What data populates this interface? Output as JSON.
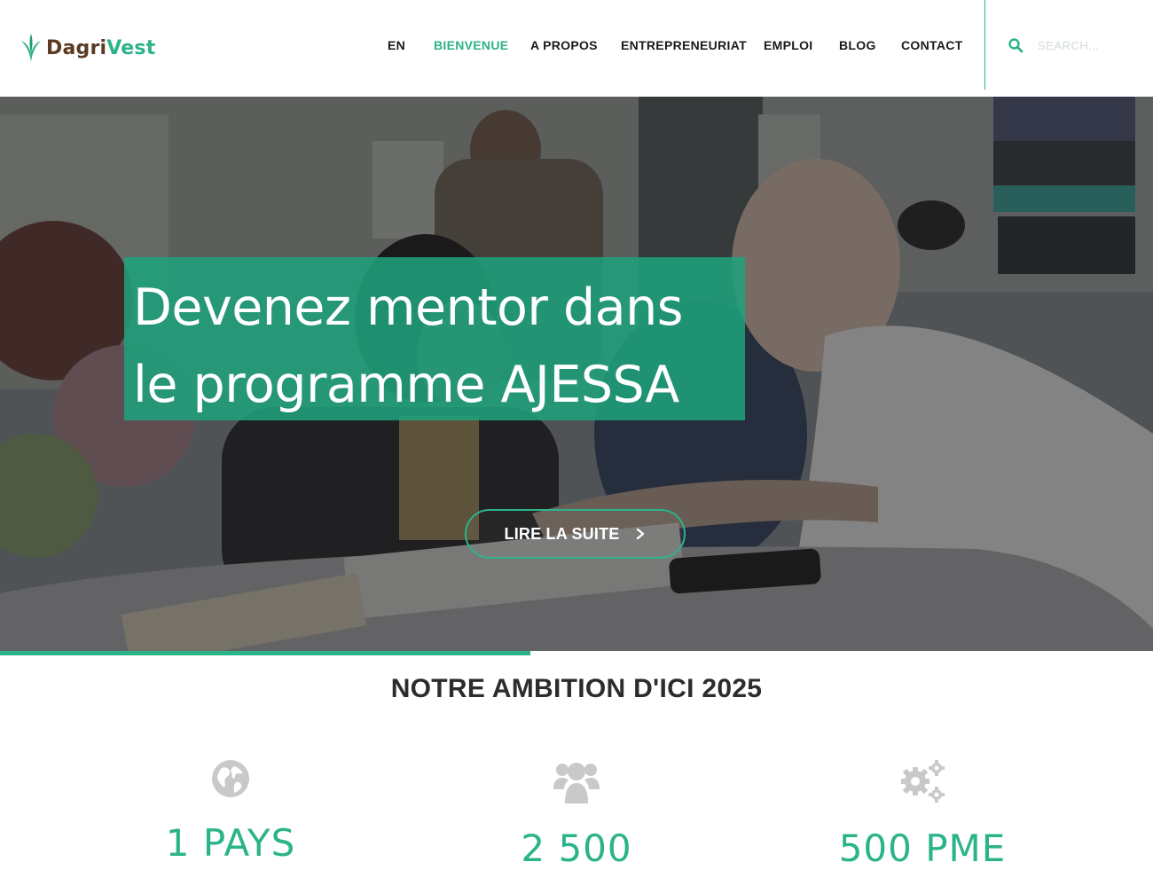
{
  "brand": {
    "name_part1": "Dagri",
    "name_part2": "Vest",
    "colors": {
      "accent": "#2bb38a",
      "brown": "#5a3a22"
    }
  },
  "nav": {
    "items": [
      {
        "label": "EN",
        "active": false
      },
      {
        "label": "BIENVENUE",
        "active": true
      },
      {
        "label": "A PROPOS",
        "active": false
      },
      {
        "label": "ENTREPRENEURIAT",
        "active": false
      },
      {
        "label": "EMPLOI",
        "active": false
      },
      {
        "label": "BLOG",
        "active": false
      },
      {
        "label": "CONTACT",
        "active": false
      }
    ]
  },
  "search": {
    "placeholder": "SEARCH...",
    "icon": "search-icon"
  },
  "hero": {
    "headline": "Devenez mentor dans le programme AJESSA",
    "cta_label": "LIRE LA SUITE",
    "cta_icon": "chevron-right-icon",
    "slider_progress": 0.46
  },
  "ambition": {
    "title": "NOTRE AMBITION D'ICI 2025",
    "stats": [
      {
        "icon": "globe-icon",
        "value": "1 PAYS"
      },
      {
        "icon": "users-icon",
        "value": "2 500"
      },
      {
        "icon": "gears-icon",
        "value": "500 PME"
      }
    ]
  }
}
